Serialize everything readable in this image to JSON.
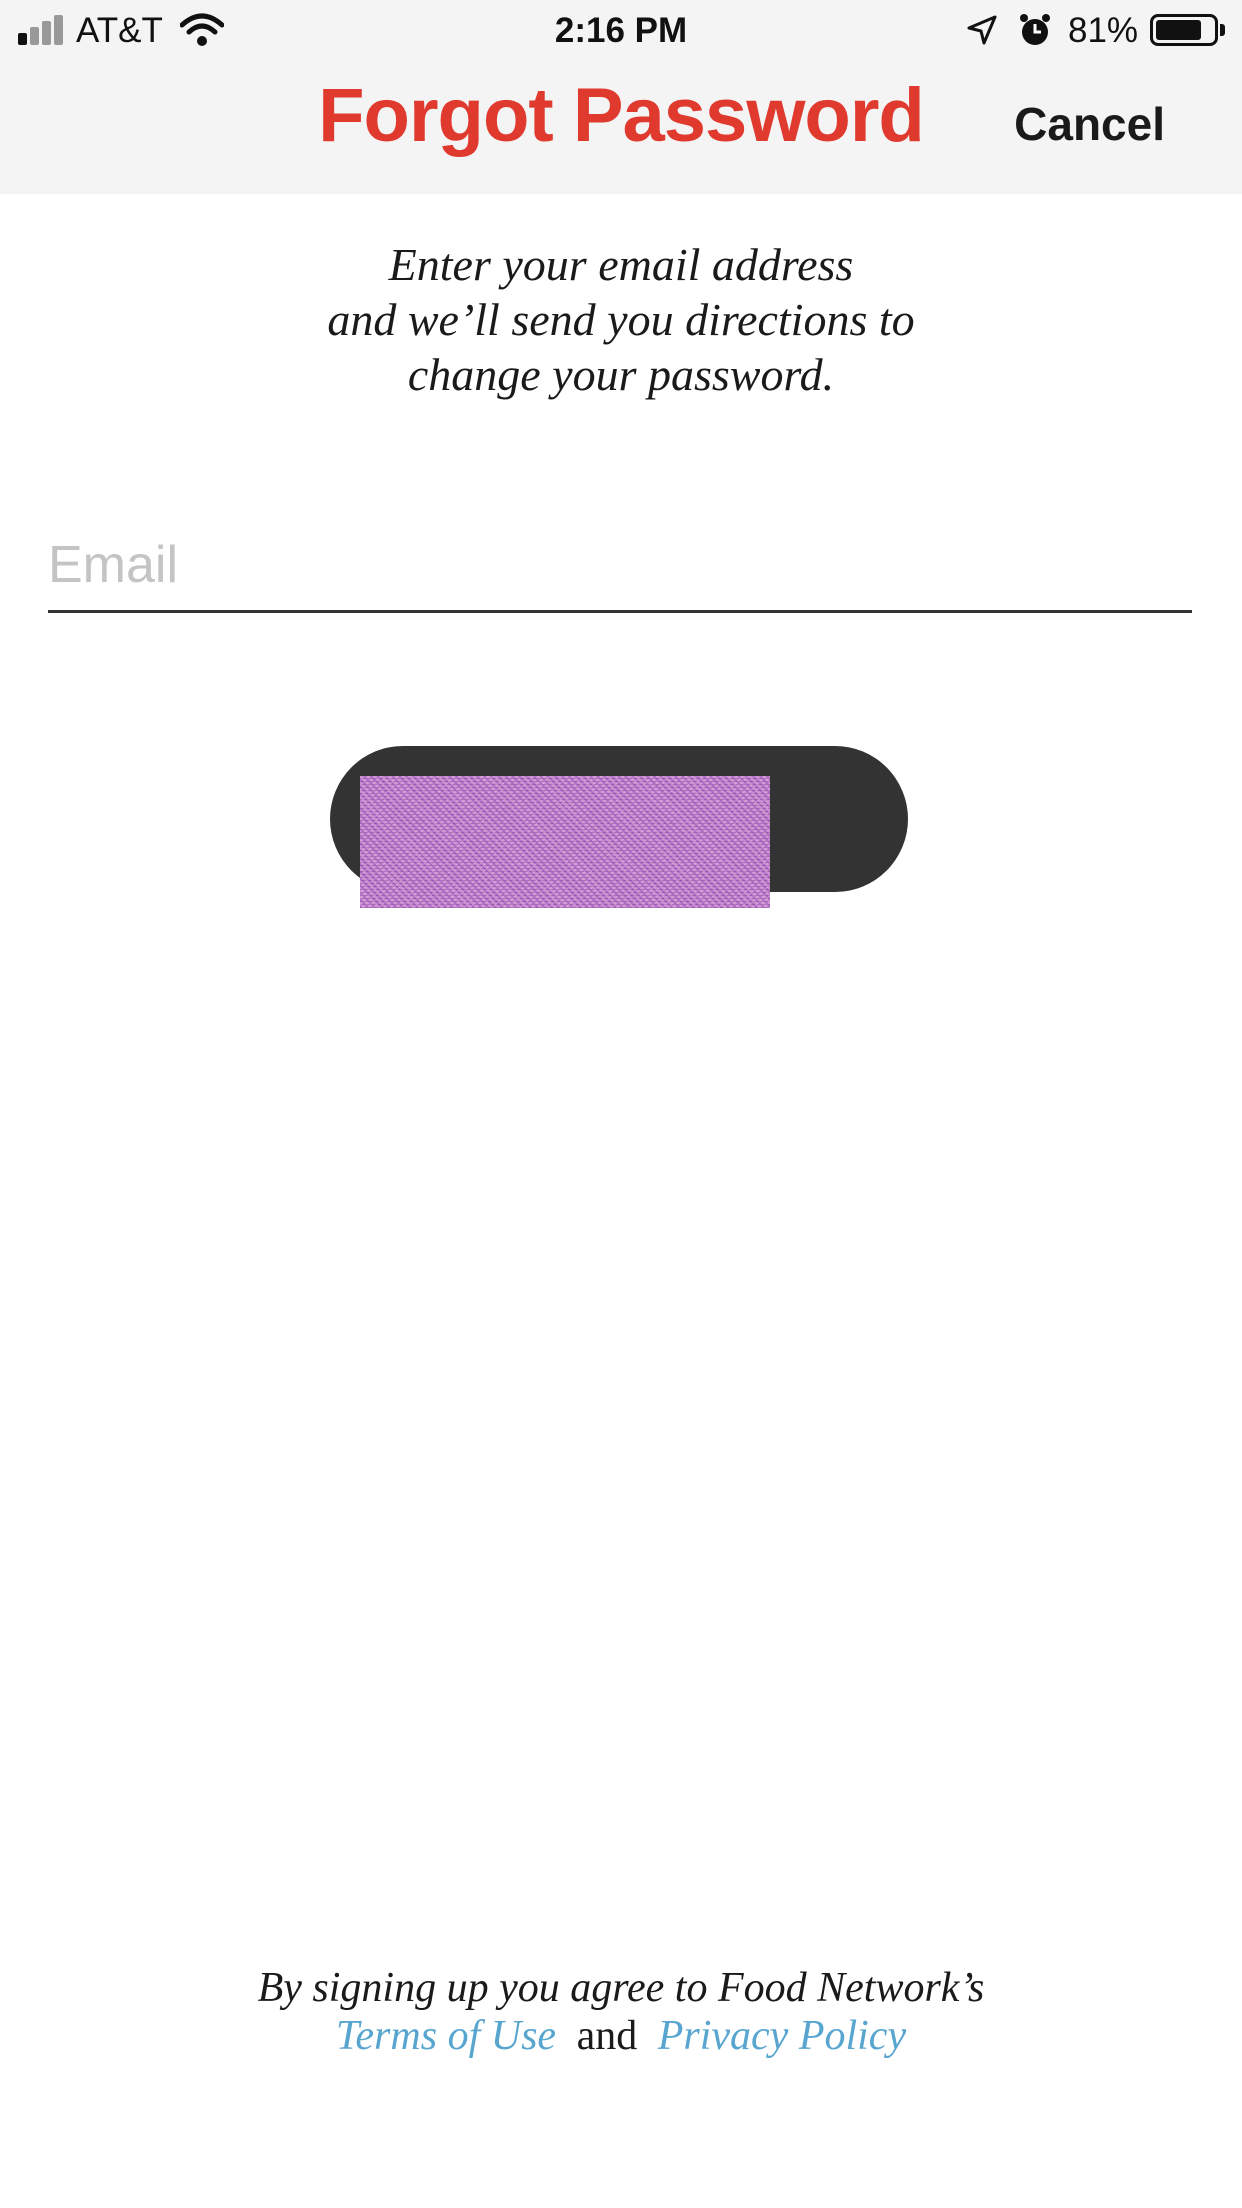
{
  "status_bar": {
    "carrier": "AT&T",
    "time": "2:16 PM",
    "battery": "81%",
    "battery_level": 0.81,
    "signal_bars_filled": 1,
    "signal_bars_total": 4,
    "icons": [
      "signal-icon",
      "wifi-icon",
      "location-arrow-icon",
      "alarm-clock-icon",
      "battery-icon"
    ]
  },
  "nav": {
    "title": "Forgot Password",
    "cancel_label": "Cancel"
  },
  "form": {
    "instructions": "Enter your email address\nand we’ll send you directions to\nchange your password.",
    "email_placeholder": "Email",
    "email_value": ""
  },
  "footer": {
    "prefix": "By signing up you agree to Food Network’s",
    "terms_label": "Terms of Use",
    "conjunction": "and",
    "privacy_label": "Privacy Policy"
  },
  "colors": {
    "title": "#e03a2f",
    "link": "#58a6cf",
    "button": "#333333",
    "header_bg": "#f4f4f4"
  }
}
